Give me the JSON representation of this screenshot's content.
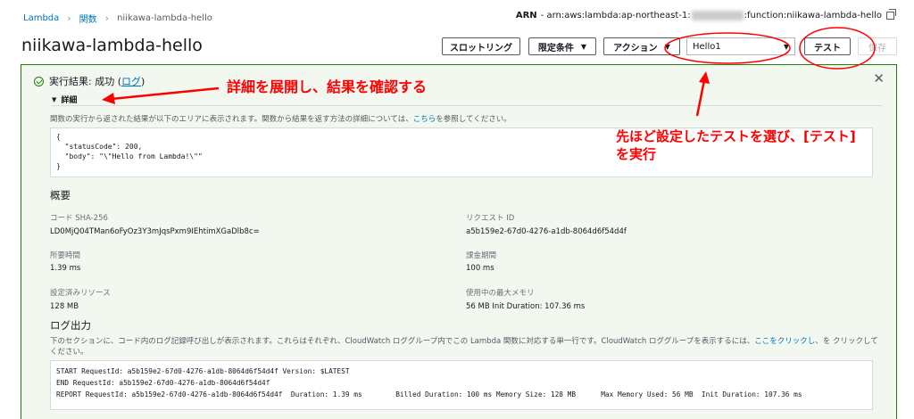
{
  "breadcrumb": {
    "root": "Lambda",
    "functions": "関数",
    "current": "niikawa-lambda-hello"
  },
  "arn": {
    "label": "ARN",
    "prefix": "- arn:aws:lambda:ap-northeast-1:",
    "suffix": ":function:niikawa-lambda-hello"
  },
  "page_title": "niikawa-lambda-hello",
  "toolbar": {
    "throttle_label": "スロットリング",
    "qualifiers_label": "限定条件",
    "actions_label": "アクション",
    "test_event_selected": "Hello1",
    "test_label": "テスト",
    "save_label": "保存"
  },
  "result": {
    "heading": "実行結果: 成功 (",
    "log_link": "ログ",
    "heading_end": ")",
    "details_label": "詳細",
    "description": "関数の実行から返された結果が以下のエリアに表示されます。関数から結果を返す方法の詳細については、",
    "description_link": "こちら",
    "description_end": "を参照してください。",
    "code": "{\n  \"statusCode\": 200,\n  \"body\": \"\\\"Hello from Lambda!\\\"\"\n}"
  },
  "summary": {
    "title": "概要",
    "code_sha_label": "コード SHA-256",
    "code_sha_value": "LD0MjQ04TMan6oFyOz3Y3mJqsPxm9IEhtimXGaDlb8c=",
    "request_id_label": "リクエスト ID",
    "request_id_value": "a5b159e2-67d0-4276-a1db-8064d6f54d4f",
    "duration_label": "所要時間",
    "duration_value": "1.39 ms",
    "billed_label": "課金期間",
    "billed_value": "100 ms",
    "resources_label": "設定済みリソース",
    "resources_value": "128 MB",
    "max_mem_label": "使用中の最大メモリ",
    "max_mem_value": "56 MB Init Duration: 107.36 ms"
  },
  "log_output": {
    "title": "ログ出力",
    "description": "下のセクションに、コード内のログ記録呼び出しが表示されます。これらはそれぞれ、CloudWatch ロググループ内でこの Lambda 関数に対応する単一行です。CloudWatch ロググループを表示するには、",
    "description_link": "ここをクリックし",
    "description_end": "、を クリックしてください。",
    "log_text": "START RequestId: a5b159e2-67d0-4276-a1db-8064d6f54d4f Version: $LATEST\nEND RequestId: a5b159e2-67d0-4276-a1db-8064d6f54d4f\nREPORT RequestId: a5b159e2-67d0-4276-a1db-8064d6f54d4f  Duration: 1.39 ms        Billed Duration: 100 ms Memory Size: 128 MB      Max Memory Used: 56 MB  Init Duration: 107.36 ms"
  },
  "annotations": {
    "details_note": "詳細を展開し、結果を確認する",
    "test_note_line1": "先ほど設定したテストを選び、[テスト]",
    "test_note_line2": "を実行"
  },
  "colors": {
    "link": "#0073bb",
    "success": "#1d8102",
    "annotation": "#ff0000"
  }
}
